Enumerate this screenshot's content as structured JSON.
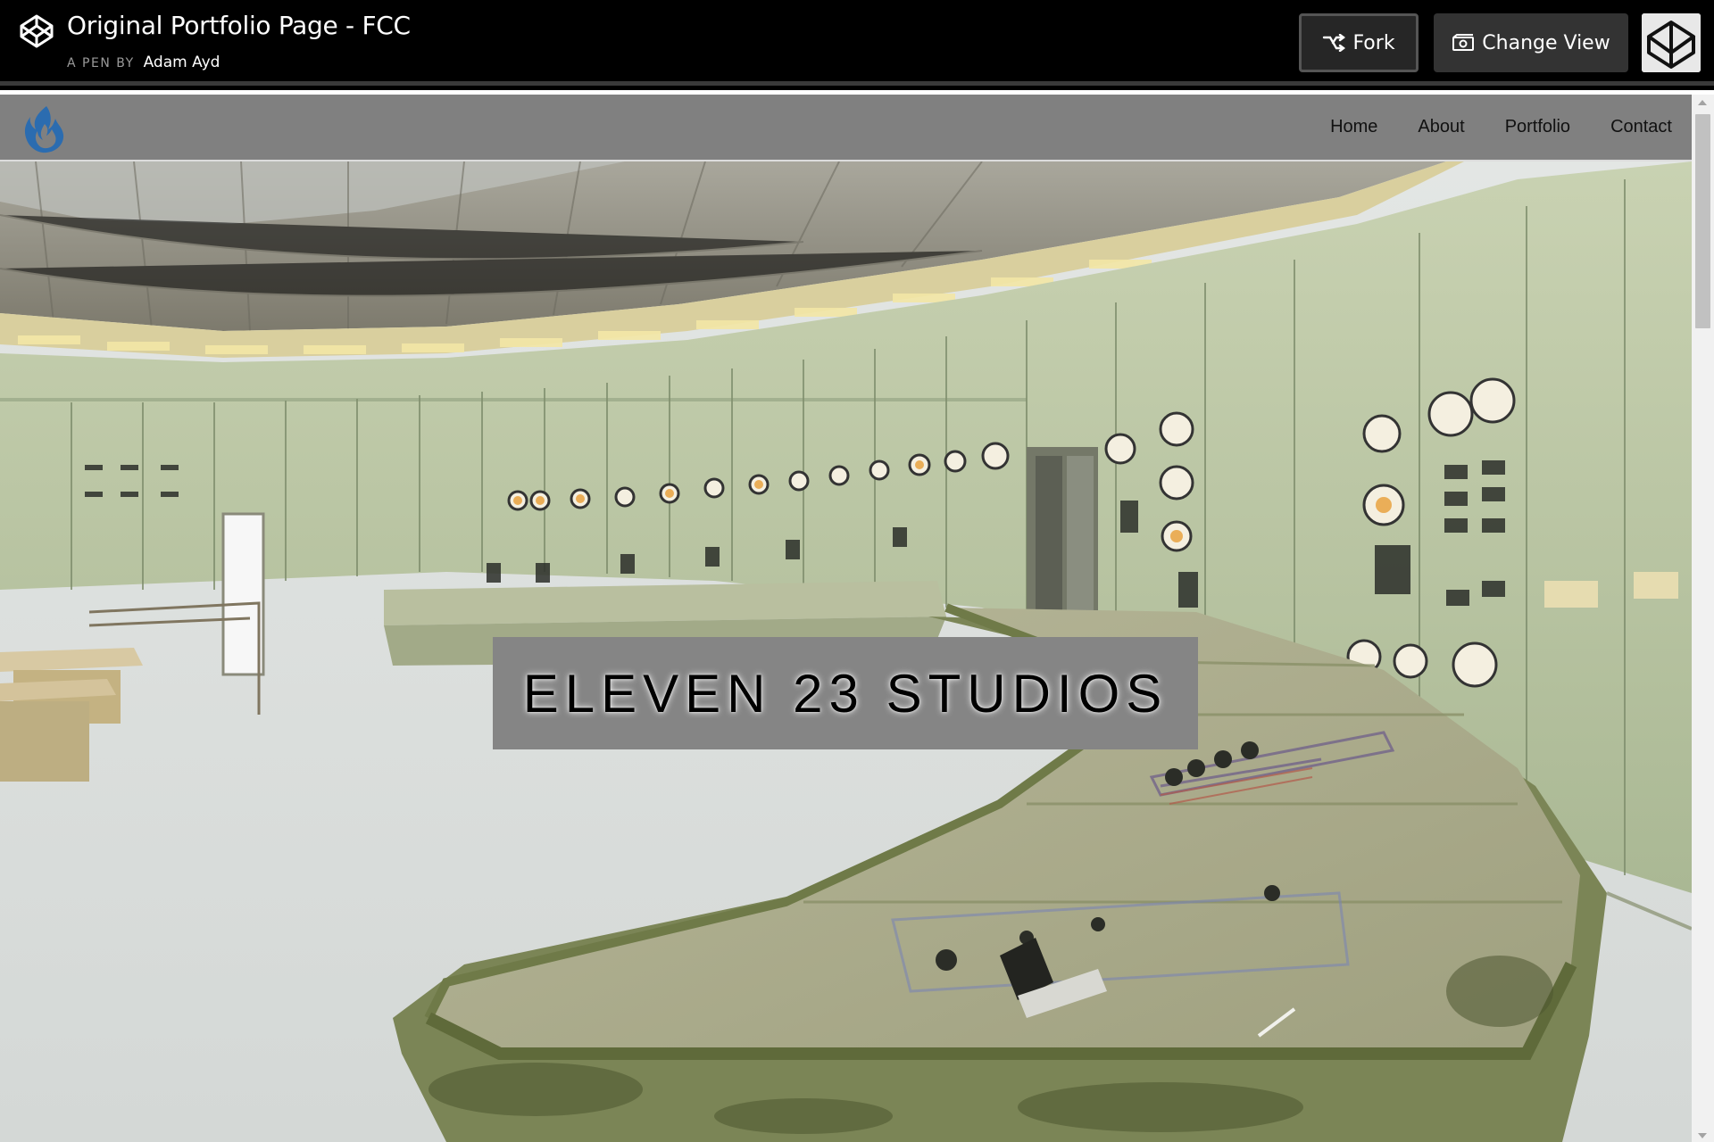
{
  "codepen": {
    "title": "Original Portfolio Page - FCC",
    "byline_prefix": "A PEN BY",
    "author": "Adam Ayd",
    "fork_label": "Fork",
    "change_view_label": "Change View"
  },
  "site": {
    "nav": [
      "Home",
      "About",
      "Portfolio",
      "Contact"
    ],
    "hero_title": "ELEVEN 23 STUDIOS"
  },
  "colors": {
    "header_bg": "#000000",
    "nav_bg": "#808080",
    "title_box": "#858585",
    "logo_blue": "#2b6cb0"
  }
}
